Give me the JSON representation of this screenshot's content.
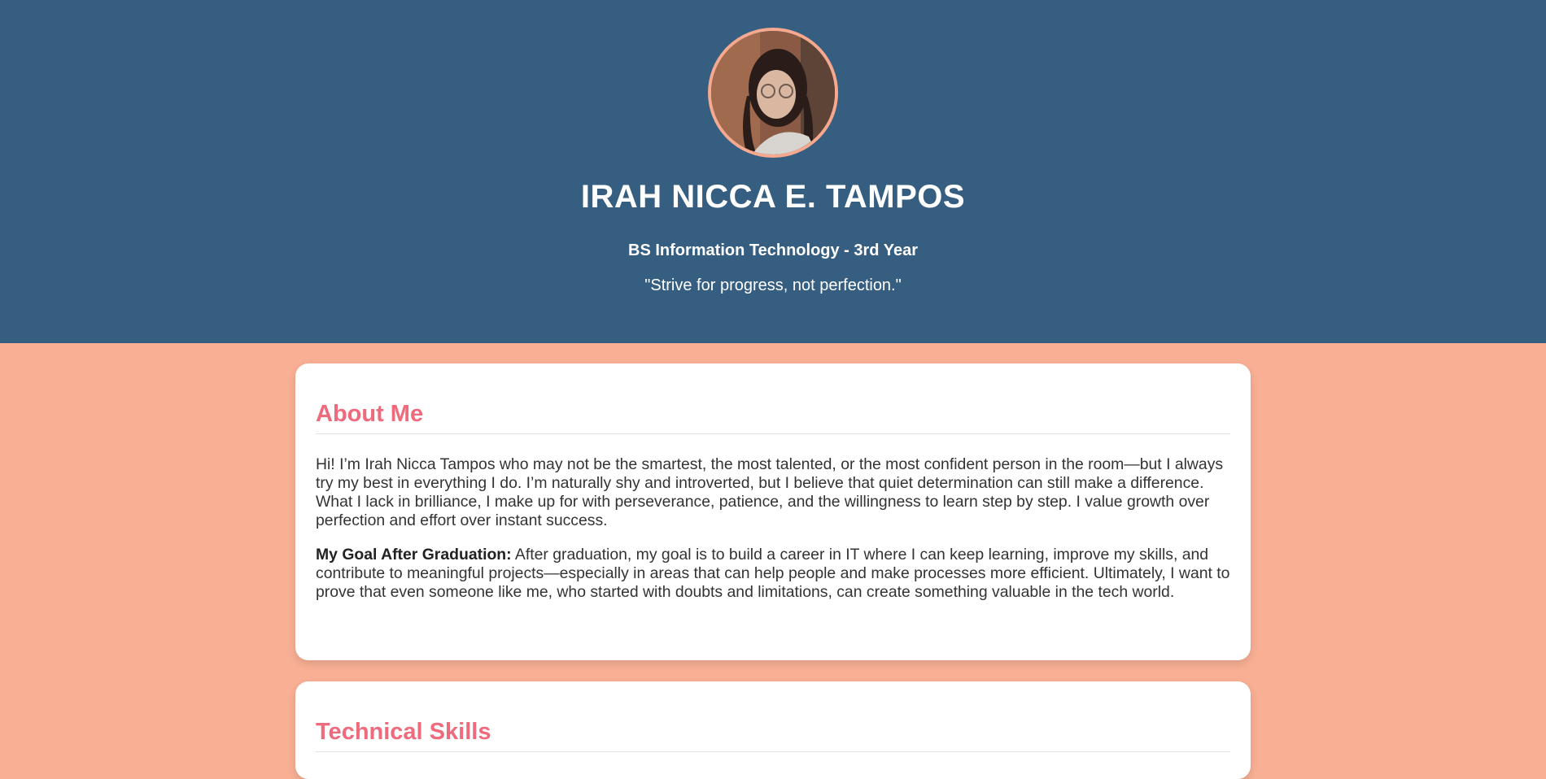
{
  "profile": {
    "name": "IRAH NICCA E. TAMPOS",
    "program": "BS Information Technology - 3rd Year",
    "motto": "\"Strive for progress, not perfection.\""
  },
  "about": {
    "title": "About Me",
    "intro": "Hi! I’m Irah Nicca Tampos who may not be the smartest, the most talented, or the most confident person in the room—but I always try my best in everything I do. I’m naturally shy and introverted, but I believe that quiet determination can still make a difference. What I lack in brilliance, I make up for with perseverance, patience, and the willingness to learn step by step. I value growth over perfection and effort over instant success.",
    "goal_label": "My Goal After Graduation:",
    "goal_text": " After graduation, my goal is to build a career in IT where I can keep learning, improve my skills, and contribute to meaningful projects—especially in areas that can help people and make processes more efficient. Ultimately, I want to prove that even someone like me, who started with doubts and limitations, can create something valuable in the tech world."
  },
  "skills": {
    "title": "Technical Skills"
  },
  "colors": {
    "header_bg": "#365e80",
    "page_bg": "#f8af94",
    "accent": "#ee6a7c"
  }
}
